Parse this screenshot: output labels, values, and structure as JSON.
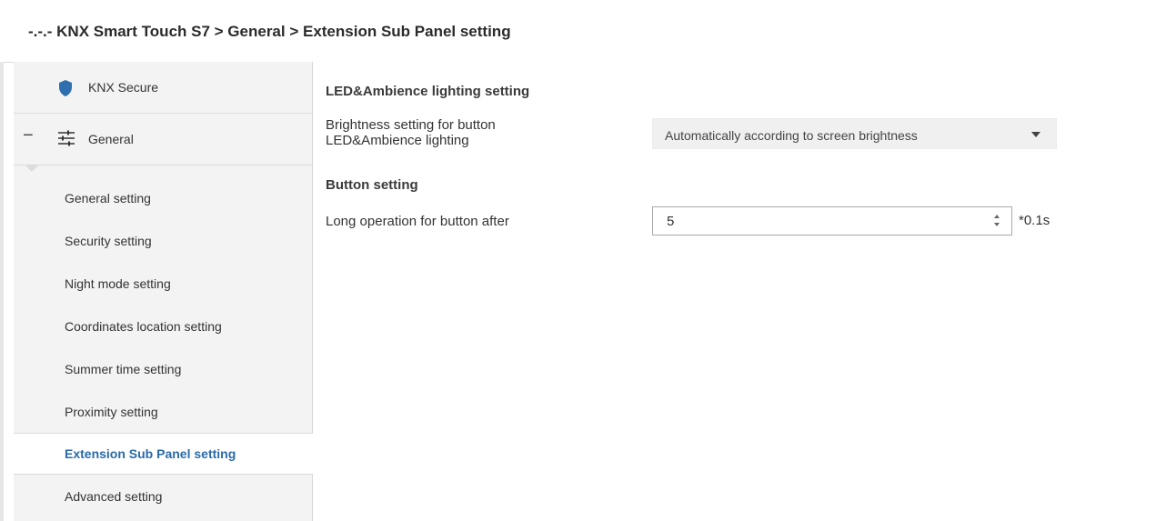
{
  "breadcrumb": "-.-.- KNX Smart Touch S7 > General > Extension Sub Panel setting",
  "sidebar": {
    "sections": [
      {
        "label": "KNX Secure",
        "icon": "shield-icon"
      },
      {
        "label": "General",
        "icon": "sliders-icon",
        "collapse_symbol": "−"
      }
    ],
    "items": [
      {
        "label": "General setting"
      },
      {
        "label": "Security setting"
      },
      {
        "label": "Night mode setting"
      },
      {
        "label": "Coordinates location setting"
      },
      {
        "label": "Summer time setting"
      },
      {
        "label": "Proximity setting"
      },
      {
        "label": "Extension Sub Panel setting",
        "active": true
      },
      {
        "label": "Advanced setting"
      }
    ]
  },
  "main": {
    "led_section_title": "LED&Ambience lighting setting",
    "brightness_label_line1": "Brightness setting for button",
    "brightness_label_line2": "LED&Ambience lighting",
    "brightness_value": "Automatically according to screen brightness",
    "button_section_title": "Button setting",
    "long_op_label": "Long operation for button after",
    "long_op_value": "5",
    "long_op_unit": "*0.1s"
  },
  "colors": {
    "accent": "#2a6aa8",
    "shield": "#2f6fb0",
    "sidebar_bg": "#f3f3f3"
  }
}
